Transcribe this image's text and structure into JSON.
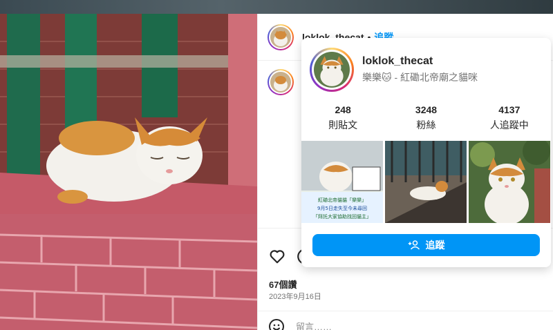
{
  "post": {
    "username": "loklok_thecat",
    "separator": "•",
    "follow_label": "追蹤",
    "likes": "67個讚",
    "date": "2023年9月16日",
    "comment_placeholder": "留言……"
  },
  "hover_card": {
    "username": "loklok_thecat",
    "full_name": "樂樂🐱 - 紅磡北帝廟之貓咪",
    "stats": [
      {
        "value": "248",
        "label": "則貼文"
      },
      {
        "value": "3248",
        "label": "粉絲"
      },
      {
        "value": "4137",
        "label": "人追蹤中"
      }
    ],
    "thumbnail_texts": {
      "line1": "紅磡北帝貓貓「樂樂」",
      "line2": "9月5日走失至今未尋回",
      "line3": "「拜託大家協助找回貓主」"
    },
    "follow_button_label": "追蹤"
  },
  "colors": {
    "accent": "#0095f6",
    "text": "#262626",
    "muted": "#737373"
  },
  "icons": [
    "heart-icon",
    "comment-icon",
    "emoji-icon",
    "add-user-icon"
  ]
}
